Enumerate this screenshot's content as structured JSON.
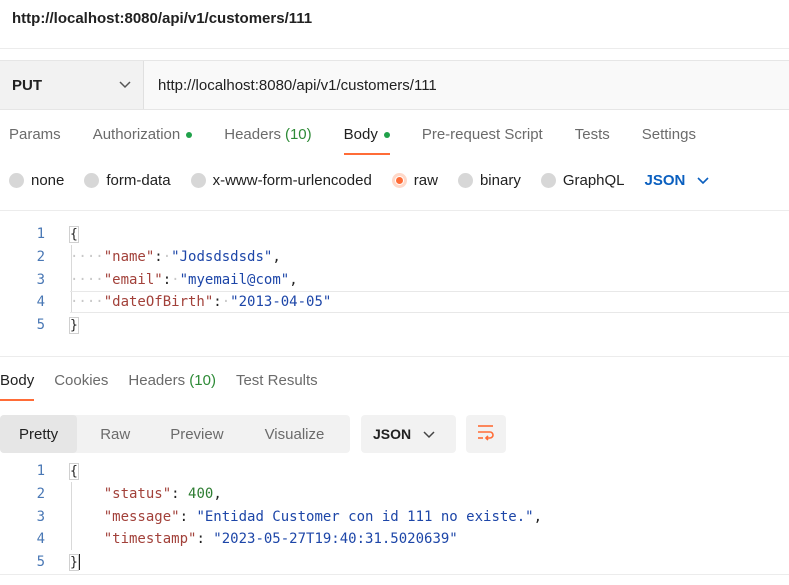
{
  "request_title": "http://localhost:8080/api/v1/customers/111",
  "request": {
    "method": "PUT",
    "url": "http://localhost:8080/api/v1/customers/111"
  },
  "request_tabs": [
    {
      "label": "Params"
    },
    {
      "label": "Authorization",
      "dot": true
    },
    {
      "label": "Headers",
      "count": "(10)"
    },
    {
      "label": "Body",
      "dot": true,
      "active": true
    },
    {
      "label": "Pre-request Script"
    },
    {
      "label": "Tests"
    },
    {
      "label": "Settings"
    }
  ],
  "body_types": [
    "none",
    "form-data",
    "x-www-form-urlencoded",
    "raw",
    "binary",
    "GraphQL"
  ],
  "body_type_selected": "raw",
  "body_format": "JSON",
  "request_body": {
    "line_numbers": [
      "1",
      "2",
      "3",
      "4",
      "5"
    ],
    "open_brace": "{",
    "close_brace": "}",
    "fields": [
      {
        "key": "\"name\"",
        "value": "\"Jodsdsdsds\"",
        "comma": ","
      },
      {
        "key": "\"email\"",
        "value": "\"myemail@com\"",
        "comma": ","
      },
      {
        "key": "\"dateOfBirth\"",
        "value": "\"2013-04-05\"",
        "comma": ""
      }
    ]
  },
  "response_tabs": [
    {
      "label": "Body",
      "active": true
    },
    {
      "label": "Cookies"
    },
    {
      "label": "Headers",
      "count": "(10)"
    },
    {
      "label": "Test Results"
    }
  ],
  "response_views": [
    "Pretty",
    "Raw",
    "Preview",
    "Visualize"
  ],
  "response_format": "JSON",
  "response_body": {
    "line_numbers": [
      "1",
      "2",
      "3",
      "4",
      "5"
    ],
    "open_brace": "{",
    "close_brace": "}",
    "fields": [
      {
        "key": "\"status\"",
        "value": "400",
        "comma": ",",
        "numeric": true
      },
      {
        "key": "\"message\"",
        "value": "\"Entidad Customer con id 111 no existe.\"",
        "comma": ","
      },
      {
        "key": "\"timestamp\"",
        "value": "\"2023-05-27T19:40:31.5020639\"",
        "comma": ""
      }
    ]
  },
  "colors": {
    "accent": "#ff6c37",
    "active_dot": "#20a14a",
    "format_link": "#0a5fbf",
    "json_key": "#a2413a",
    "json_string": "#1d46a8"
  }
}
